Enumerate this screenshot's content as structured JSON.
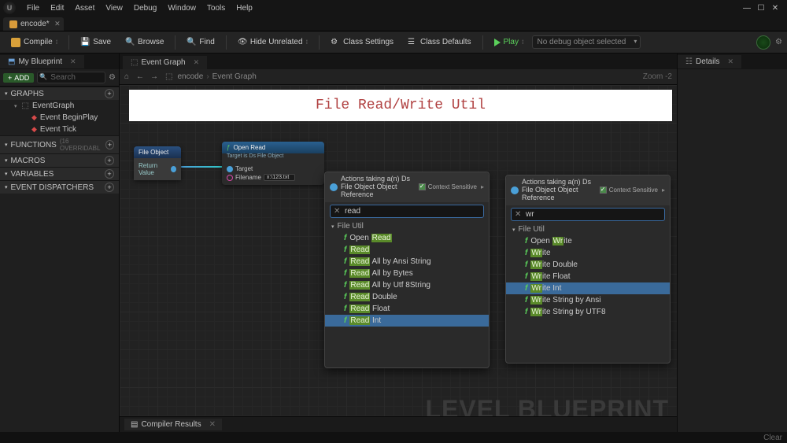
{
  "menu": {
    "file": "File",
    "edit": "Edit",
    "asset": "Asset",
    "view": "View",
    "debug": "Debug",
    "window": "Window",
    "tools": "Tools",
    "help": "Help"
  },
  "doc_tab": {
    "label": "encode*"
  },
  "toolbar": {
    "compile": "Compile",
    "save": "Save",
    "browse": "Browse",
    "find": "Find",
    "hide_unrelated": "Hide Unrelated",
    "class_settings": "Class Settings",
    "class_defaults": "Class Defaults",
    "play": "Play",
    "debug_sel": "No debug object selected"
  },
  "left": {
    "tab": "My Blueprint",
    "add": "ADD",
    "search_ph": "Search",
    "graphs": "GRAPHS",
    "eventgraph": "EventGraph",
    "beginplay": "Event BeginPlay",
    "tick": "Event Tick",
    "functions": "FUNCTIONS",
    "functions_sub": "(16 OVERRIDABL",
    "macros": "MACROS",
    "variables": "VARIABLES",
    "dispatchers": "EVENT DISPATCHERS"
  },
  "center": {
    "tab": "Event Graph",
    "bc_item1": "encode",
    "bc_item2": "Event Graph",
    "zoom": "Zoom -2",
    "banner": "File Read/Write Util",
    "node1_title": "File Object",
    "node1_pin": "Return Value",
    "node2_title": "Open Read",
    "node2_sub": "Target is Ds File Object",
    "node2_target": "Target",
    "node2_filename": "Filename",
    "node2_fileval": "x:\\123.txt",
    "watermark": "LEVEL BLUEPRINT"
  },
  "popup_read": {
    "title": "Actions taking a(n) Ds File Object Object Reference",
    "ctx": "Context Sensitive",
    "search": "read",
    "cat": "File Util",
    "items": [
      {
        "pre": "Open ",
        "hl": "Read",
        "post": ""
      },
      {
        "pre": "",
        "hl": "Read",
        "post": ""
      },
      {
        "pre": "",
        "hl": "Read",
        "post": " All by Ansi String"
      },
      {
        "pre": "",
        "hl": "Read",
        "post": " All by Bytes"
      },
      {
        "pre": "",
        "hl": "Read",
        "post": " All by Utf 8String"
      },
      {
        "pre": "",
        "hl": "Read",
        "post": " Double"
      },
      {
        "pre": "",
        "hl": "Read",
        "post": " Float"
      },
      {
        "pre": "",
        "hl": "Read",
        "post": " Int",
        "sel": true
      }
    ]
  },
  "popup_write": {
    "title": "Actions taking a(n) Ds File Object Object Reference",
    "ctx": "Context Sensitive",
    "search": "wr",
    "cat": "File Util",
    "items": [
      {
        "pre": "Open ",
        "hl": "Wr",
        "post": "ite"
      },
      {
        "pre": "",
        "hl": "Wr",
        "post": "ite"
      },
      {
        "pre": "",
        "hl": "Wr",
        "post": "ite Double"
      },
      {
        "pre": "",
        "hl": "Wr",
        "post": "ite Float"
      },
      {
        "pre": "",
        "hl": "Wr",
        "post": "ite Int",
        "sel": true
      },
      {
        "pre": "",
        "hl": "Wr",
        "post": "ite String by Ansi"
      },
      {
        "pre": "",
        "hl": "Wr",
        "post": "ite String by UTF8"
      }
    ]
  },
  "right": {
    "tab": "Details"
  },
  "compiler": {
    "tab": "Compiler Results"
  },
  "status": {
    "clear": "Clear"
  }
}
